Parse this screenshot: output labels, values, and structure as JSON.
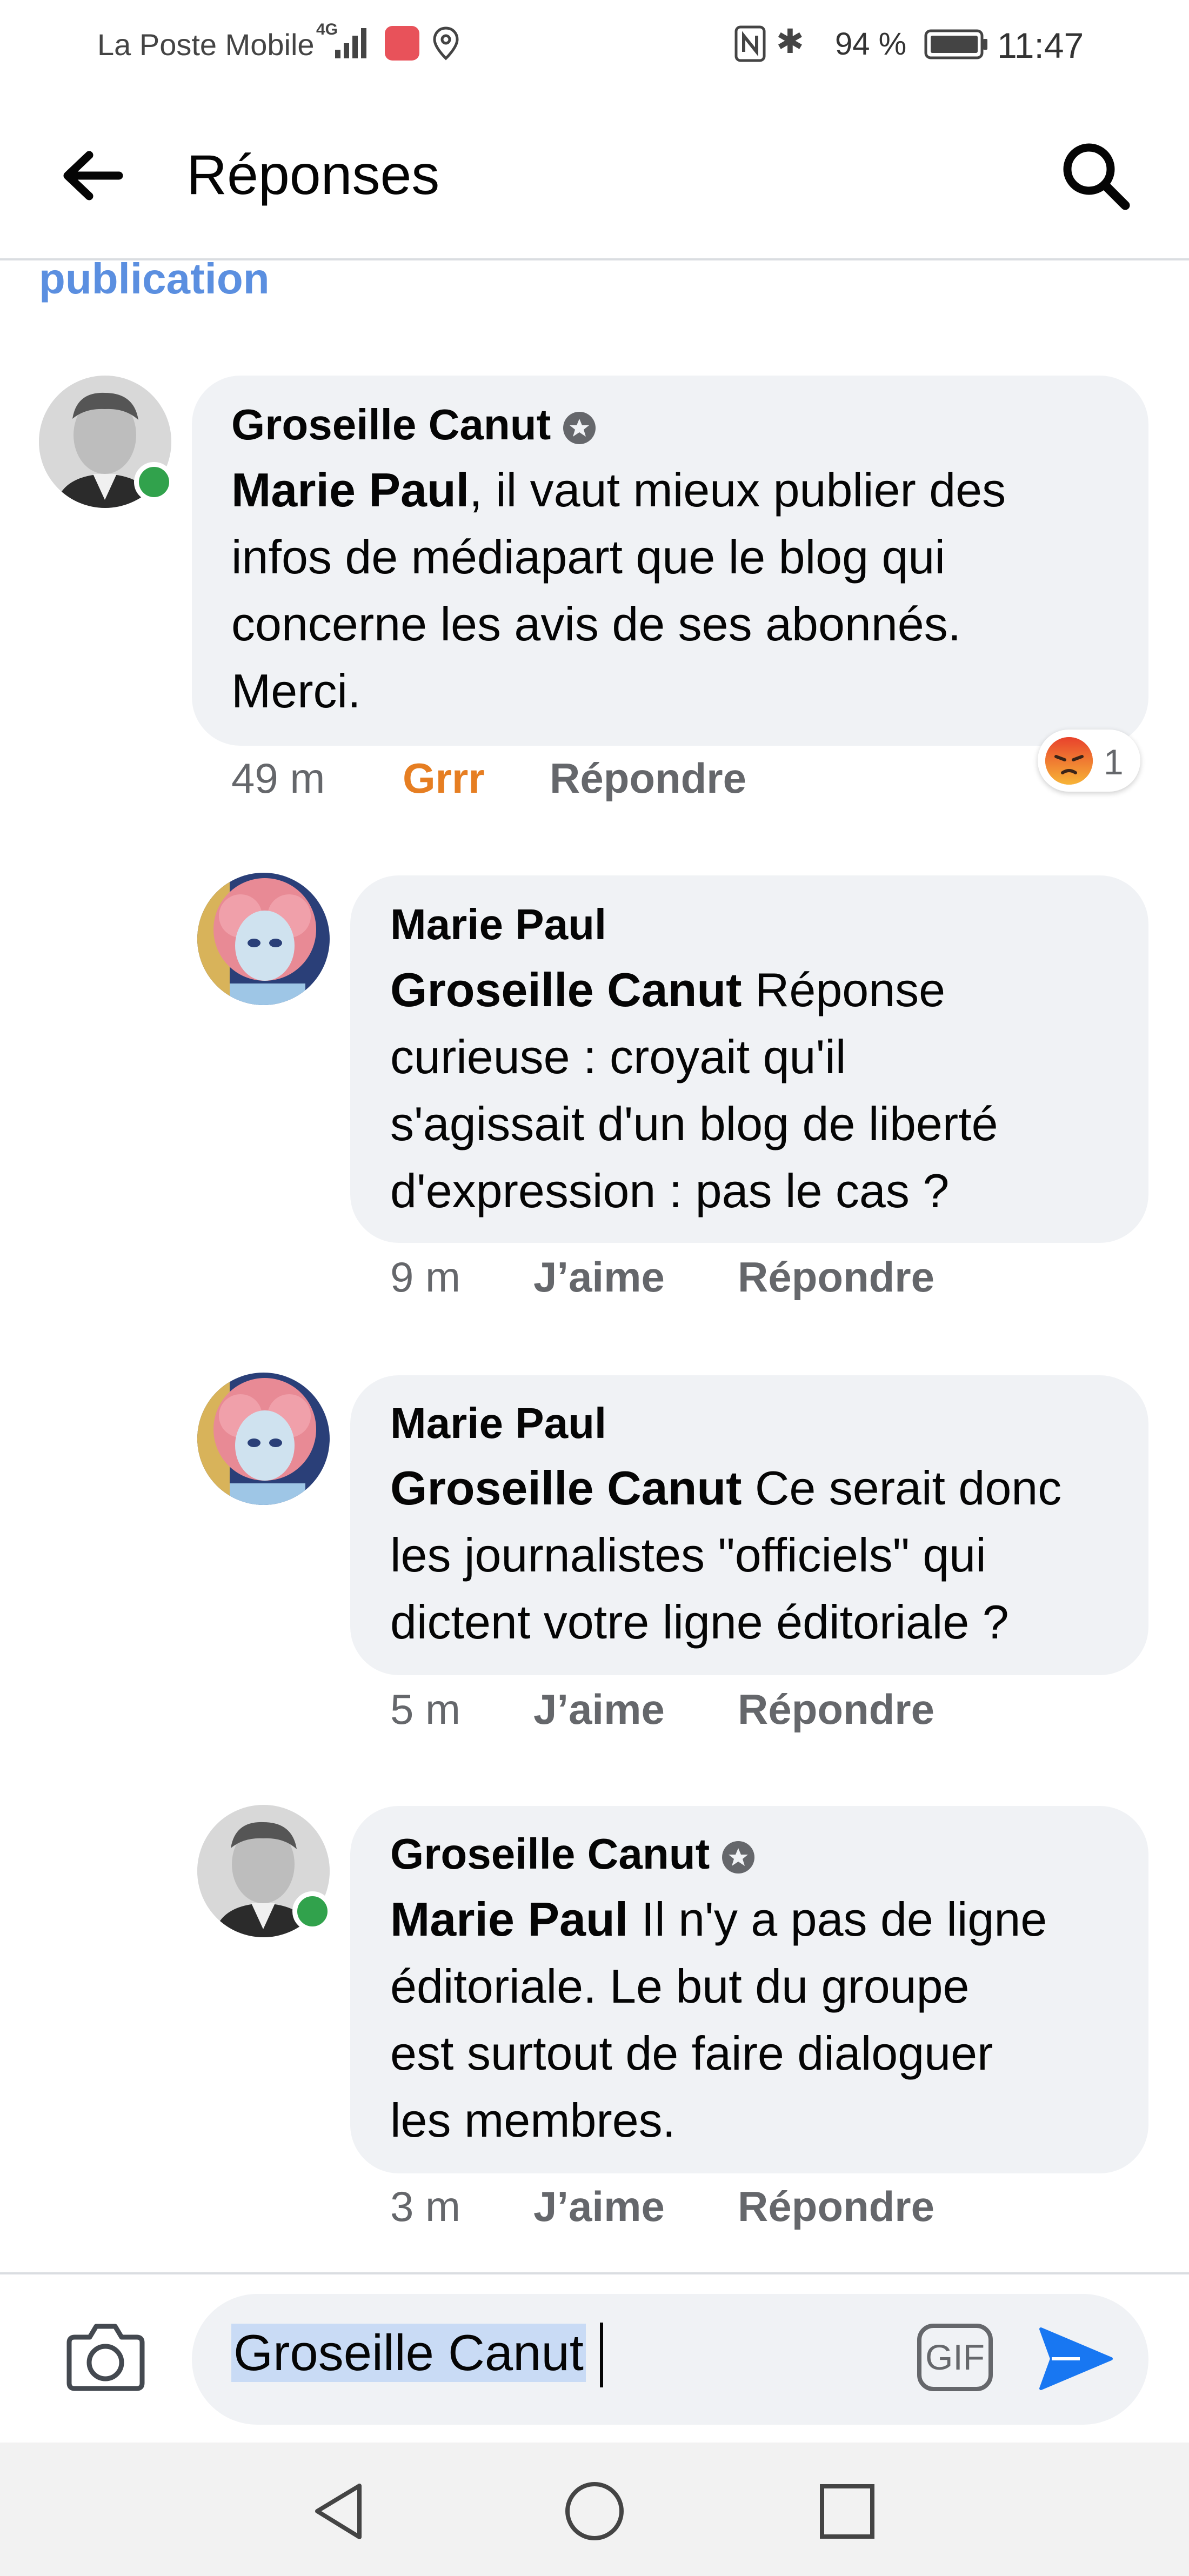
{
  "status_bar": {
    "carrier": "La Poste Mobile",
    "network": "4G",
    "battery": "94 %",
    "time": "11:47"
  },
  "header": {
    "title": "Réponses",
    "back_icon": "arrow-left-icon",
    "search_icon": "search-icon"
  },
  "link_above": "publication",
  "comments": [
    {
      "author": "Groseille Canut",
      "verified": true,
      "online": true,
      "mention": "Marie Paul",
      "lines": [
        ", il vaut mieux publier des",
        "infos de médiapart que le blog qui",
        "concerne les avis de ses abonnés.",
        "Merci."
      ],
      "time": "49 m",
      "reaction_label": "Grrr",
      "reaction_color": "#e67e22",
      "reply_label": "Répondre",
      "reaction_count": "1",
      "reaction_icon": "angry-face-icon"
    },
    {
      "author": "Marie Paul",
      "mention": "Groseille Canut",
      "lines": [
        " Réponse",
        "curieuse : croyait qu'il",
        "s'agissait d'un blog de liberté",
        "d'expression : pas le cas ?"
      ],
      "time": "9 m",
      "like_label": "J’aime",
      "reply_label": "Répondre"
    },
    {
      "author": "Marie Paul",
      "mention": "Groseille Canut",
      "lines": [
        " Ce serait donc",
        "les journalistes \"officiels\" qui",
        "dictent votre ligne éditoriale ?"
      ],
      "time": "5 m",
      "like_label": "J’aime",
      "reply_label": "Répondre"
    },
    {
      "author": "Groseille Canut",
      "verified": true,
      "online": true,
      "mention": "Marie Paul",
      "lines": [
        " Il n'y a pas de ligne",
        "éditoriale. Le but du groupe",
        "est surtout de faire dialoguer",
        "les membres."
      ],
      "time": "3 m",
      "like_label": "J’aime",
      "reply_label": "Répondre"
    }
  ],
  "composer": {
    "value": "Groseille Canut",
    "gif_label": "GIF",
    "camera_icon": "camera-icon",
    "send_icon": "send-icon",
    "accent": "#1877f2"
  },
  "nav": {
    "back": "nav-back-icon",
    "home": "nav-home-icon",
    "recents": "nav-recents-icon"
  }
}
